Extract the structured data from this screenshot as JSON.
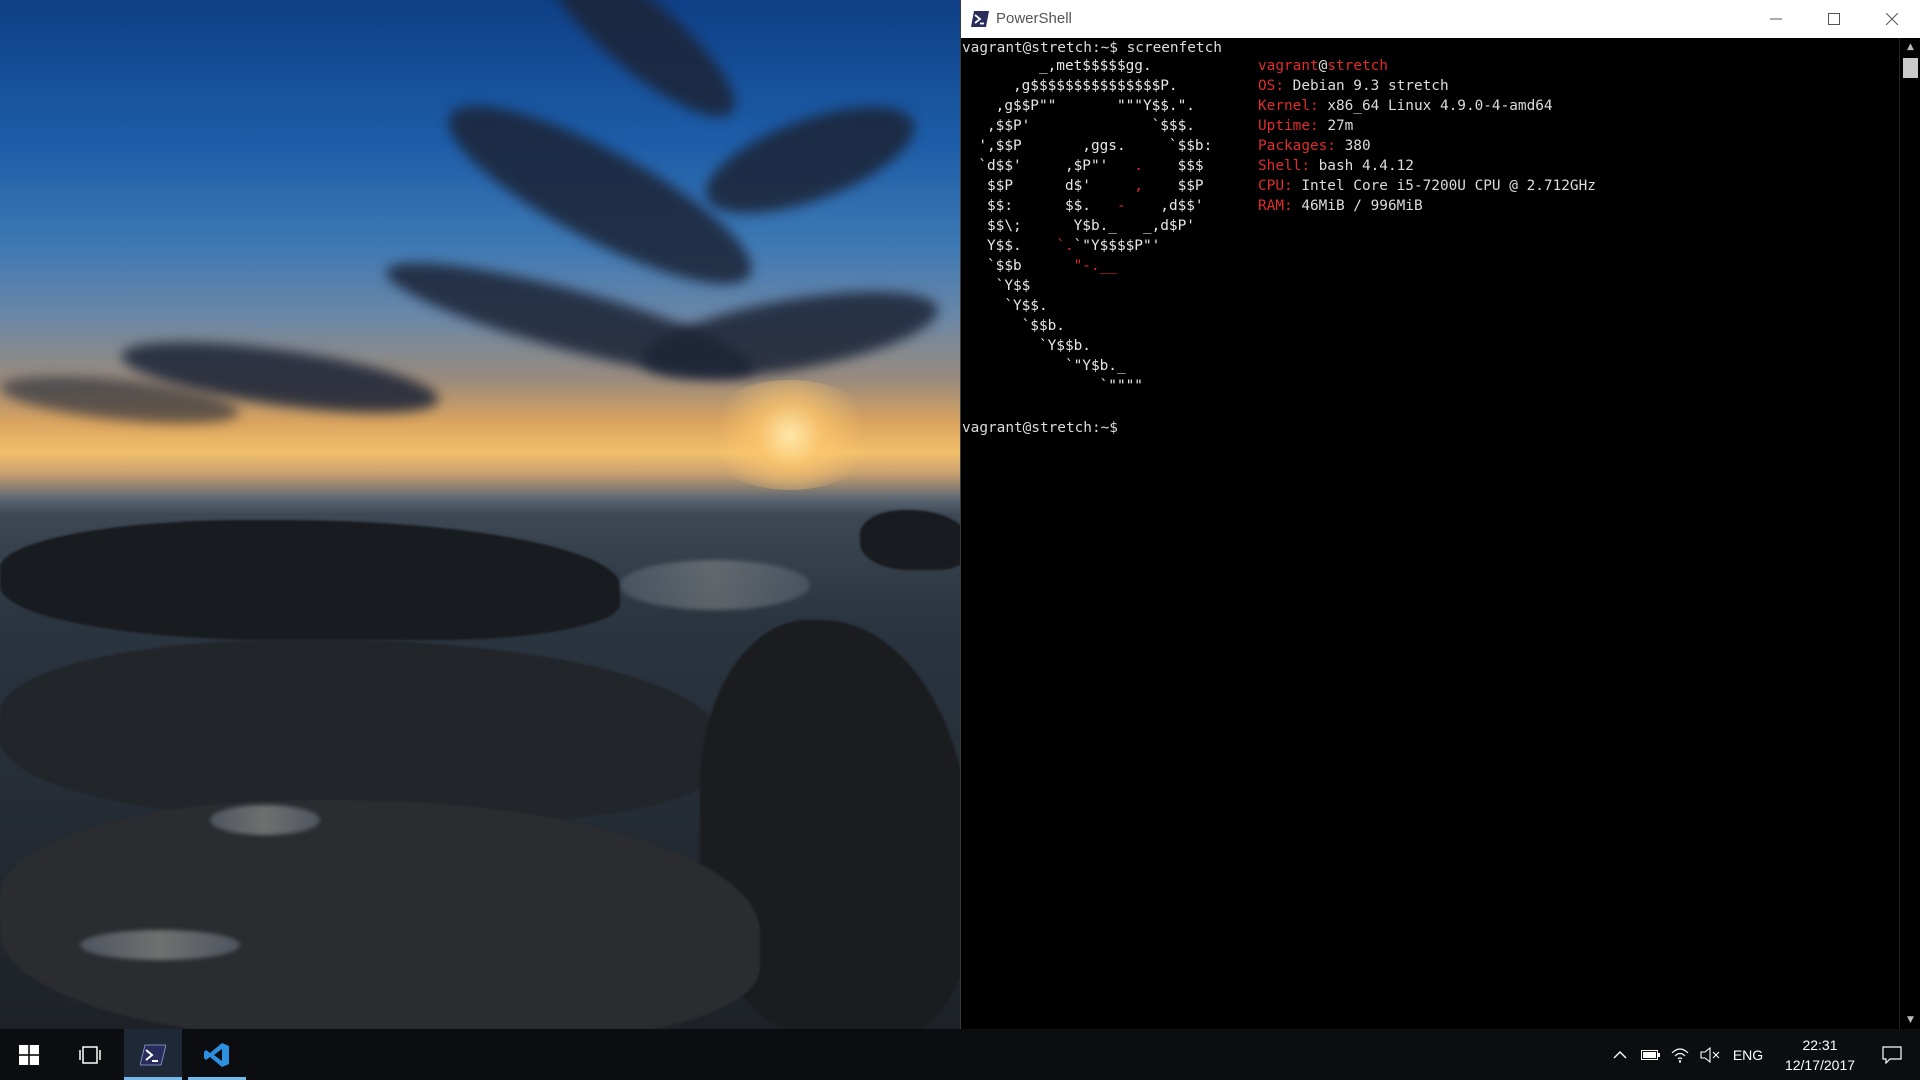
{
  "window": {
    "title": "PowerShell",
    "minimize_label": "—",
    "maximize_label": "☐",
    "close_label": "✕"
  },
  "terminal": {
    "command_line": "vagrant@stretch:~$ screenfetch",
    "prompt_line": "vagrant@stretch:~$",
    "art": [
      [
        {
          "t": "         _,met$$$$$gg.",
          "c": "w"
        }
      ],
      [
        {
          "t": "      ,g$$$$$$$$$$$$$$$P.",
          "c": "w"
        }
      ],
      [
        {
          "t": "    ,g$$P\"\"       \"\"\"Y$$.\".",
          "c": "w"
        }
      ],
      [
        {
          "t": "   ,$$P'              `$$$.",
          "c": "w"
        }
      ],
      [
        {
          "t": "  ',$$P       ,ggs.     `$$b:",
          "c": "w"
        }
      ],
      [
        {
          "t": "  `d$$'     ,$P\"'   ",
          "c": "w"
        },
        {
          "t": ".",
          "c": "r"
        },
        {
          "t": "    $$$",
          "c": "w"
        }
      ],
      [
        {
          "t": "   $$P      d$'     ",
          "c": "w"
        },
        {
          "t": ",",
          "c": "r"
        },
        {
          "t": "    $$P",
          "c": "w"
        }
      ],
      [
        {
          "t": "   $$:      $$.   ",
          "c": "w"
        },
        {
          "t": "-",
          "c": "r"
        },
        {
          "t": "    ,d$$'",
          "c": "w"
        }
      ],
      [
        {
          "t": "   $$\\;      Y$b._   _,d$P'",
          "c": "w"
        }
      ],
      [
        {
          "t": "   Y$$.    ",
          "c": "w"
        },
        {
          "t": "`.",
          "c": "r"
        },
        {
          "t": "`\"Y$$$$P\"'",
          "c": "w"
        }
      ],
      [
        {
          "t": "   `$$b      ",
          "c": "w"
        },
        {
          "t": "\"-.__",
          "c": "r"
        }
      ],
      [
        {
          "t": "    `Y$$",
          "c": "w"
        }
      ],
      [
        {
          "t": "     `Y$$.",
          "c": "w"
        }
      ],
      [
        {
          "t": "       `$$b.",
          "c": "w"
        }
      ],
      [
        {
          "t": "         `Y$$b.",
          "c": "w"
        }
      ],
      [
        {
          "t": "            `\"Y$b._",
          "c": "w"
        }
      ],
      [
        {
          "t": "                `\"\"\"\"",
          "c": "w"
        }
      ]
    ],
    "info_user": "vagrant",
    "info_at": "@",
    "info_host": "stretch",
    "info": [
      {
        "key": "OS:",
        "value": " Debian 9.3 stretch"
      },
      {
        "key": "Kernel:",
        "value": " x86_64 Linux 4.9.0-4-amd64"
      },
      {
        "key": "Uptime:",
        "value": " 27m"
      },
      {
        "key": "Packages:",
        "value": " 380"
      },
      {
        "key": "Shell:",
        "value": " bash 4.4.12"
      },
      {
        "key": "CPU:",
        "value": " Intel Core i5-7200U CPU @ 2.712GHz"
      },
      {
        "key": "RAM:",
        "value": " 46MiB / 996MiB"
      }
    ]
  },
  "taskbar": {
    "language": "ENG",
    "time": "22:31",
    "date": "12/17/2017",
    "accent": "#76b9ed"
  },
  "colors": {
    "terminal_bg": "#000000",
    "terminal_fg": "#dcdcdc",
    "terminal_red": "#e02c2c",
    "taskbar_bg": "#0c0d10"
  }
}
